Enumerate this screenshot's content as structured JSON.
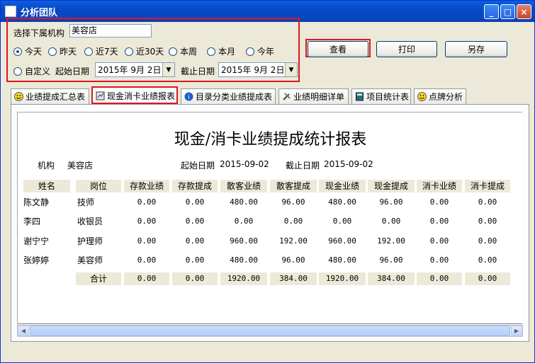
{
  "window": {
    "title": "分析团队",
    "minimize": "_",
    "maximize": "□",
    "close": "×"
  },
  "filter": {
    "org_label": "选择下属机构",
    "org_value": "美容店",
    "radios": [
      {
        "label": "今天",
        "checked": true
      },
      {
        "label": "昨天",
        "checked": false
      },
      {
        "label": "近7天",
        "checked": false
      },
      {
        "label": "近30天",
        "checked": false
      },
      {
        "label": "本周",
        "checked": false
      },
      {
        "label": "本月",
        "checked": false
      },
      {
        "label": "今年",
        "checked": false
      }
    ],
    "custom_label": "自定义",
    "start_label": "起始日期",
    "start_value": "2015年 9月 2日",
    "end_label": "截止日期",
    "end_value": "2015年 9月 2日"
  },
  "buttons": {
    "query": "查看",
    "print": "打印",
    "save": "另存"
  },
  "tabs": [
    {
      "label": "业绩提成汇总表",
      "icon": "smiley-icon"
    },
    {
      "label": "现金消卡业绩报表",
      "icon": "report-icon"
    },
    {
      "label": "目录分类业绩提成表",
      "icon": "info-icon"
    },
    {
      "label": "业绩明细详单",
      "icon": "tools-icon"
    },
    {
      "label": "项目统计表",
      "icon": "calculator-icon"
    },
    {
      "label": "点牌分析",
      "icon": "smiley-icon"
    }
  ],
  "report": {
    "title": "现金/消卡业绩提成统计报表",
    "org_label": "机构",
    "org_value": "美容店",
    "start_label": "起始日期",
    "start_value": "2015-09-02",
    "end_label": "截止日期",
    "end_value": "2015-09-02",
    "columns": [
      "姓名",
      "岗位",
      "存款业绩",
      "存款提成",
      "散客业绩",
      "散客提成",
      "现金业绩",
      "现金提成",
      "消卡业绩",
      "消卡提成"
    ],
    "rows": [
      [
        "陈文静",
        "技师",
        "0.00",
        "0.00",
        "480.00",
        "96.00",
        "480.00",
        "96.00",
        "0.00",
        "0.00"
      ],
      [
        "李四",
        "收银员",
        "0.00",
        "0.00",
        "0.00",
        "0.00",
        "0.00",
        "0.00",
        "0.00",
        "0.00"
      ],
      [
        "谢宁宁",
        "护理师",
        "0.00",
        "0.00",
        "960.00",
        "192.00",
        "960.00",
        "192.00",
        "0.00",
        "0.00"
      ],
      [
        "张婷婷",
        "美容师",
        "0.00",
        "0.00",
        "480.00",
        "96.00",
        "480.00",
        "96.00",
        "0.00",
        "0.00"
      ]
    ],
    "total": [
      "合计",
      "0.00",
      "0.00",
      "1920.00",
      "384.00",
      "1920.00",
      "384.00",
      "0.00",
      "0.00"
    ]
  }
}
